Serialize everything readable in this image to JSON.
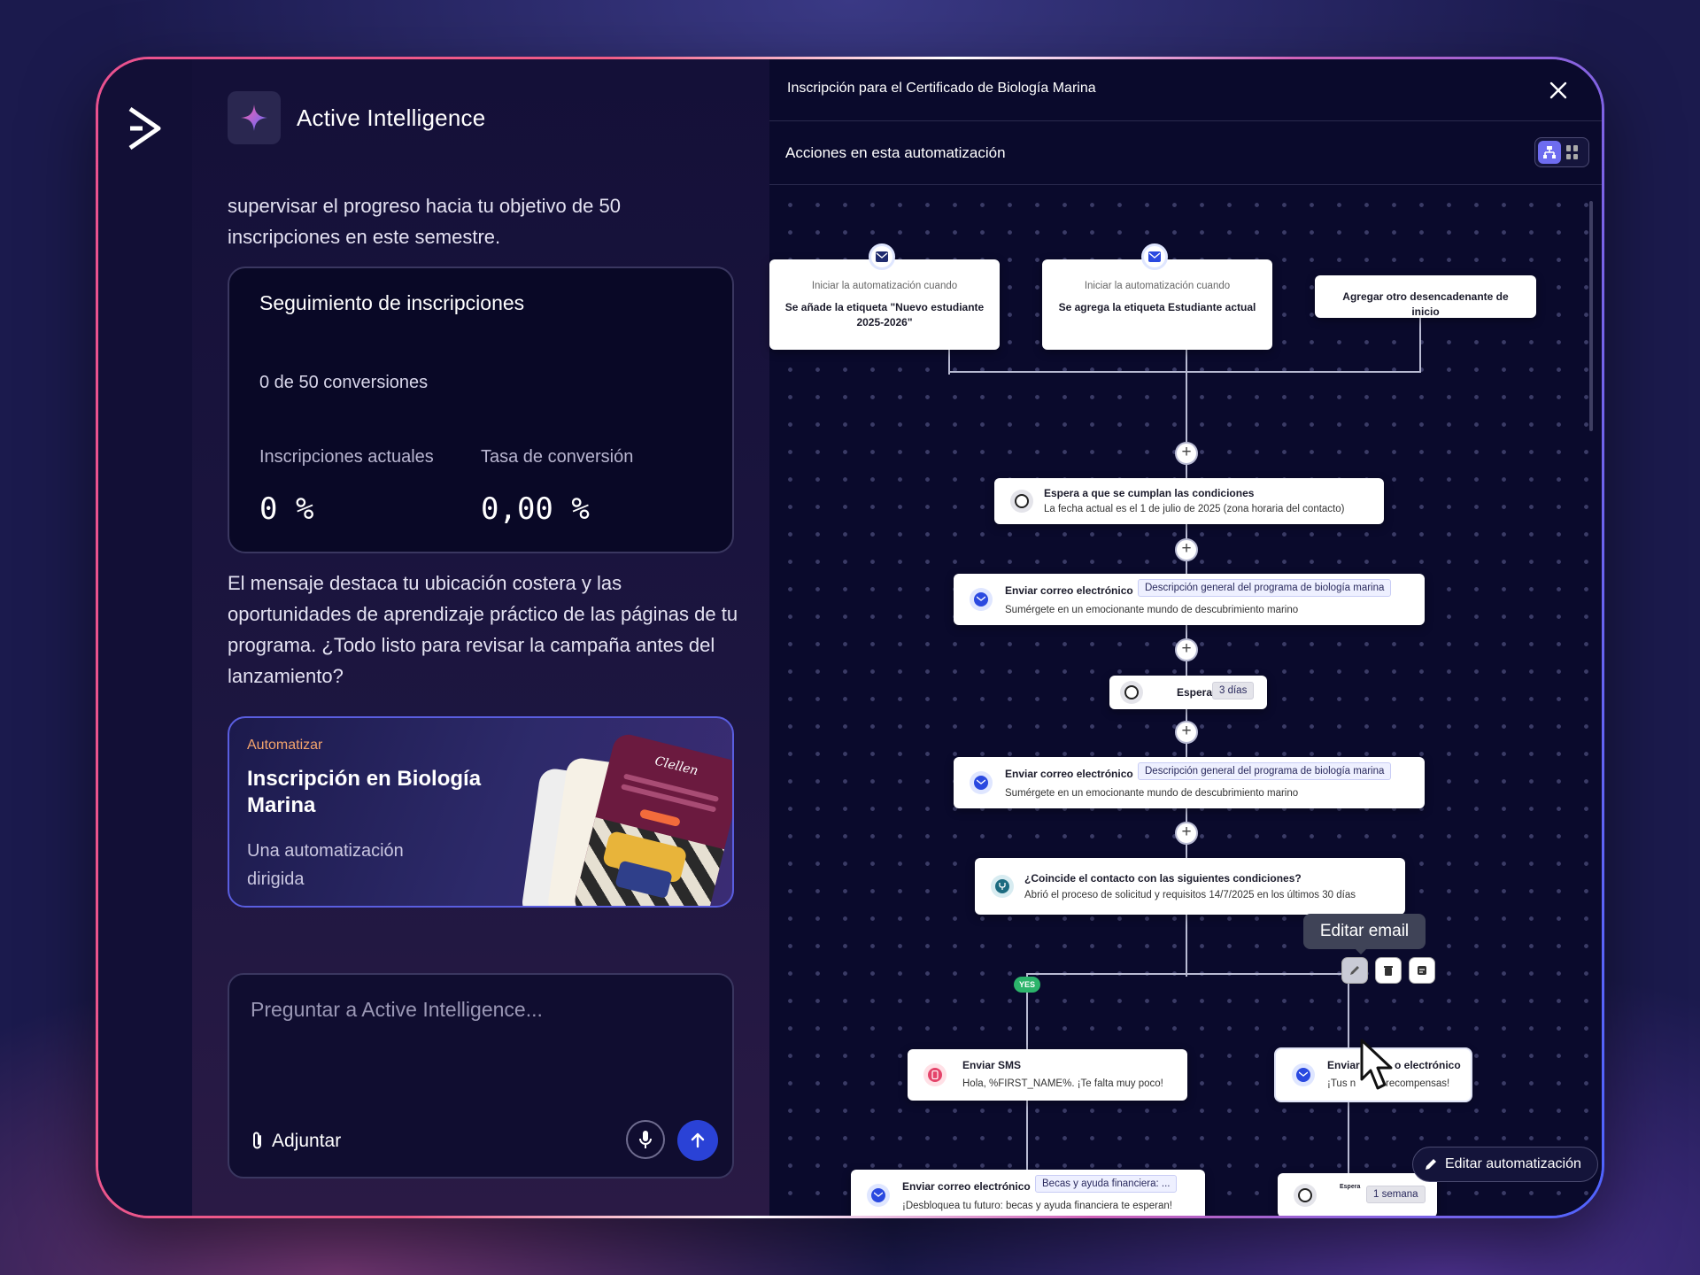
{
  "colors": {
    "accent": "#2a42d6",
    "frame_pink": "#e9518f",
    "frame_blue": "#4d63ff",
    "flow_bg": "#0a0a2c",
    "yes_green": "#2cb46b"
  },
  "chat": {
    "title": "Active Intelligence",
    "intro_text": "supervisar el progreso hacia tu objetivo de 50 inscripciones en este semestre.",
    "tracking_card": {
      "title": "Seguimiento de inscripciones",
      "conversions": "0 de 50 conversiones",
      "stats": [
        {
          "label": "Inscripciones actuales",
          "value": "0 %"
        },
        {
          "label": "Tasa de conversión",
          "value": "0,00 %"
        }
      ]
    },
    "message_text": "El mensaje destaca tu ubicación costera y las oportunidades de aprendizaje práctico de las páginas de tu programa. ¿Todo listo para revisar la campaña antes del lanzamiento?",
    "automation_card": {
      "kicker": "Automatizar",
      "title": "Inscripción en Biología Marina",
      "description": "Una automatización dirigida",
      "preview_brand": "Clellen"
    },
    "input": {
      "placeholder": "Preguntar a Active Intelligence...",
      "attach_label": "Adjuntar"
    }
  },
  "flow": {
    "title": "Inscripción para el Certificado de Biología Marina",
    "subtitle": "Acciones en esta automatización",
    "triggers": [
      {
        "caption": "Iniciar la automatización cuando",
        "text": "Se añade la etiqueta \"Nuevo estudiante 2025-2026\""
      },
      {
        "caption": "Iniciar la automatización cuando",
        "text": "Se agrega la etiqueta Estudiante actual"
      }
    ],
    "add_trigger": "Agregar otro desencadenante de inicio",
    "wait_conditions": {
      "label": "Espera a que se cumplan las condiciones",
      "desc": "La fecha actual es el 1 de julio de 2025 (zona horaria del contacto)"
    },
    "email_1": {
      "label": "Enviar correo electrónico",
      "pill": "Descripción general del programa de biología marina",
      "desc": "Sumérgete en un emocionante mundo de descubrimiento marino"
    },
    "wait_days": {
      "label": "Esperar",
      "pill": "3 días"
    },
    "email_2": {
      "label": "Enviar correo electrónico",
      "pill": "Descripción general del programa de biología marina",
      "desc": "Sumérgete en un emocionante mundo de descubrimiento marino"
    },
    "condition": {
      "label": "¿Coincide el contacto con las siguientes condiciones?",
      "desc": "Abrió el proceso de solicitud y requisitos 14/7/2025 en los últimos 30 días"
    },
    "yes_label": "YES",
    "sms": {
      "label": "Enviar SMS",
      "desc": "Hola, %FIRST_NAME%. ¡Te falta muy poco!"
    },
    "email_right": {
      "label_a": "Enviar",
      "label_b": "o electrónico",
      "desc_a": "¡Tus n",
      "desc_b": "recompensas!"
    },
    "tooltip": "Editar email",
    "email_scholar": {
      "label": "Enviar correo electrónico",
      "pill": "Becas y ayuda financiera: ...",
      "desc": "¡Desbloquea tu futuro: becas y ayuda financiera te esperan!"
    },
    "wait_week": {
      "label": "Espera",
      "pill": "1 semana"
    },
    "edit_automation": "Editar automatización"
  }
}
